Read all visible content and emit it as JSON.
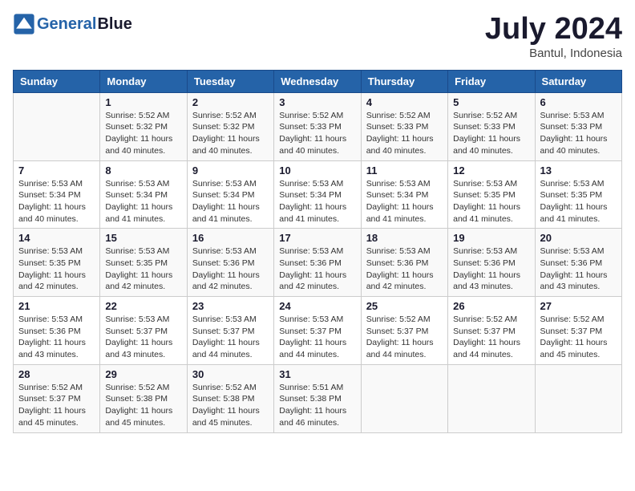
{
  "header": {
    "logo_line1": "General",
    "logo_line2": "Blue",
    "month": "July 2024",
    "location": "Bantul, Indonesia"
  },
  "days_of_week": [
    "Sunday",
    "Monday",
    "Tuesday",
    "Wednesday",
    "Thursday",
    "Friday",
    "Saturday"
  ],
  "weeks": [
    [
      {
        "day": "",
        "sunrise": "",
        "sunset": "",
        "daylight": ""
      },
      {
        "day": "1",
        "sunrise": "Sunrise: 5:52 AM",
        "sunset": "Sunset: 5:32 PM",
        "daylight": "Daylight: 11 hours and 40 minutes."
      },
      {
        "day": "2",
        "sunrise": "Sunrise: 5:52 AM",
        "sunset": "Sunset: 5:32 PM",
        "daylight": "Daylight: 11 hours and 40 minutes."
      },
      {
        "day": "3",
        "sunrise": "Sunrise: 5:52 AM",
        "sunset": "Sunset: 5:33 PM",
        "daylight": "Daylight: 11 hours and 40 minutes."
      },
      {
        "day": "4",
        "sunrise": "Sunrise: 5:52 AM",
        "sunset": "Sunset: 5:33 PM",
        "daylight": "Daylight: 11 hours and 40 minutes."
      },
      {
        "day": "5",
        "sunrise": "Sunrise: 5:52 AM",
        "sunset": "Sunset: 5:33 PM",
        "daylight": "Daylight: 11 hours and 40 minutes."
      },
      {
        "day": "6",
        "sunrise": "Sunrise: 5:53 AM",
        "sunset": "Sunset: 5:33 PM",
        "daylight": "Daylight: 11 hours and 40 minutes."
      }
    ],
    [
      {
        "day": "7",
        "sunrise": "Sunrise: 5:53 AM",
        "sunset": "Sunset: 5:34 PM",
        "daylight": "Daylight: 11 hours and 40 minutes."
      },
      {
        "day": "8",
        "sunrise": "Sunrise: 5:53 AM",
        "sunset": "Sunset: 5:34 PM",
        "daylight": "Daylight: 11 hours and 41 minutes."
      },
      {
        "day": "9",
        "sunrise": "Sunrise: 5:53 AM",
        "sunset": "Sunset: 5:34 PM",
        "daylight": "Daylight: 11 hours and 41 minutes."
      },
      {
        "day": "10",
        "sunrise": "Sunrise: 5:53 AM",
        "sunset": "Sunset: 5:34 PM",
        "daylight": "Daylight: 11 hours and 41 minutes."
      },
      {
        "day": "11",
        "sunrise": "Sunrise: 5:53 AM",
        "sunset": "Sunset: 5:34 PM",
        "daylight": "Daylight: 11 hours and 41 minutes."
      },
      {
        "day": "12",
        "sunrise": "Sunrise: 5:53 AM",
        "sunset": "Sunset: 5:35 PM",
        "daylight": "Daylight: 11 hours and 41 minutes."
      },
      {
        "day": "13",
        "sunrise": "Sunrise: 5:53 AM",
        "sunset": "Sunset: 5:35 PM",
        "daylight": "Daylight: 11 hours and 41 minutes."
      }
    ],
    [
      {
        "day": "14",
        "sunrise": "Sunrise: 5:53 AM",
        "sunset": "Sunset: 5:35 PM",
        "daylight": "Daylight: 11 hours and 42 minutes."
      },
      {
        "day": "15",
        "sunrise": "Sunrise: 5:53 AM",
        "sunset": "Sunset: 5:35 PM",
        "daylight": "Daylight: 11 hours and 42 minutes."
      },
      {
        "day": "16",
        "sunrise": "Sunrise: 5:53 AM",
        "sunset": "Sunset: 5:36 PM",
        "daylight": "Daylight: 11 hours and 42 minutes."
      },
      {
        "day": "17",
        "sunrise": "Sunrise: 5:53 AM",
        "sunset": "Sunset: 5:36 PM",
        "daylight": "Daylight: 11 hours and 42 minutes."
      },
      {
        "day": "18",
        "sunrise": "Sunrise: 5:53 AM",
        "sunset": "Sunset: 5:36 PM",
        "daylight": "Daylight: 11 hours and 42 minutes."
      },
      {
        "day": "19",
        "sunrise": "Sunrise: 5:53 AM",
        "sunset": "Sunset: 5:36 PM",
        "daylight": "Daylight: 11 hours and 43 minutes."
      },
      {
        "day": "20",
        "sunrise": "Sunrise: 5:53 AM",
        "sunset": "Sunset: 5:36 PM",
        "daylight": "Daylight: 11 hours and 43 minutes."
      }
    ],
    [
      {
        "day": "21",
        "sunrise": "Sunrise: 5:53 AM",
        "sunset": "Sunset: 5:36 PM",
        "daylight": "Daylight: 11 hours and 43 minutes."
      },
      {
        "day": "22",
        "sunrise": "Sunrise: 5:53 AM",
        "sunset": "Sunset: 5:37 PM",
        "daylight": "Daylight: 11 hours and 43 minutes."
      },
      {
        "day": "23",
        "sunrise": "Sunrise: 5:53 AM",
        "sunset": "Sunset: 5:37 PM",
        "daylight": "Daylight: 11 hours and 44 minutes."
      },
      {
        "day": "24",
        "sunrise": "Sunrise: 5:53 AM",
        "sunset": "Sunset: 5:37 PM",
        "daylight": "Daylight: 11 hours and 44 minutes."
      },
      {
        "day": "25",
        "sunrise": "Sunrise: 5:52 AM",
        "sunset": "Sunset: 5:37 PM",
        "daylight": "Daylight: 11 hours and 44 minutes."
      },
      {
        "day": "26",
        "sunrise": "Sunrise: 5:52 AM",
        "sunset": "Sunset: 5:37 PM",
        "daylight": "Daylight: 11 hours and 44 minutes."
      },
      {
        "day": "27",
        "sunrise": "Sunrise: 5:52 AM",
        "sunset": "Sunset: 5:37 PM",
        "daylight": "Daylight: 11 hours and 45 minutes."
      }
    ],
    [
      {
        "day": "28",
        "sunrise": "Sunrise: 5:52 AM",
        "sunset": "Sunset: 5:37 PM",
        "daylight": "Daylight: 11 hours and 45 minutes."
      },
      {
        "day": "29",
        "sunrise": "Sunrise: 5:52 AM",
        "sunset": "Sunset: 5:38 PM",
        "daylight": "Daylight: 11 hours and 45 minutes."
      },
      {
        "day": "30",
        "sunrise": "Sunrise: 5:52 AM",
        "sunset": "Sunset: 5:38 PM",
        "daylight": "Daylight: 11 hours and 45 minutes."
      },
      {
        "day": "31",
        "sunrise": "Sunrise: 5:51 AM",
        "sunset": "Sunset: 5:38 PM",
        "daylight": "Daylight: 11 hours and 46 minutes."
      },
      {
        "day": "",
        "sunrise": "",
        "sunset": "",
        "daylight": ""
      },
      {
        "day": "",
        "sunrise": "",
        "sunset": "",
        "daylight": ""
      },
      {
        "day": "",
        "sunrise": "",
        "sunset": "",
        "daylight": ""
      }
    ]
  ]
}
